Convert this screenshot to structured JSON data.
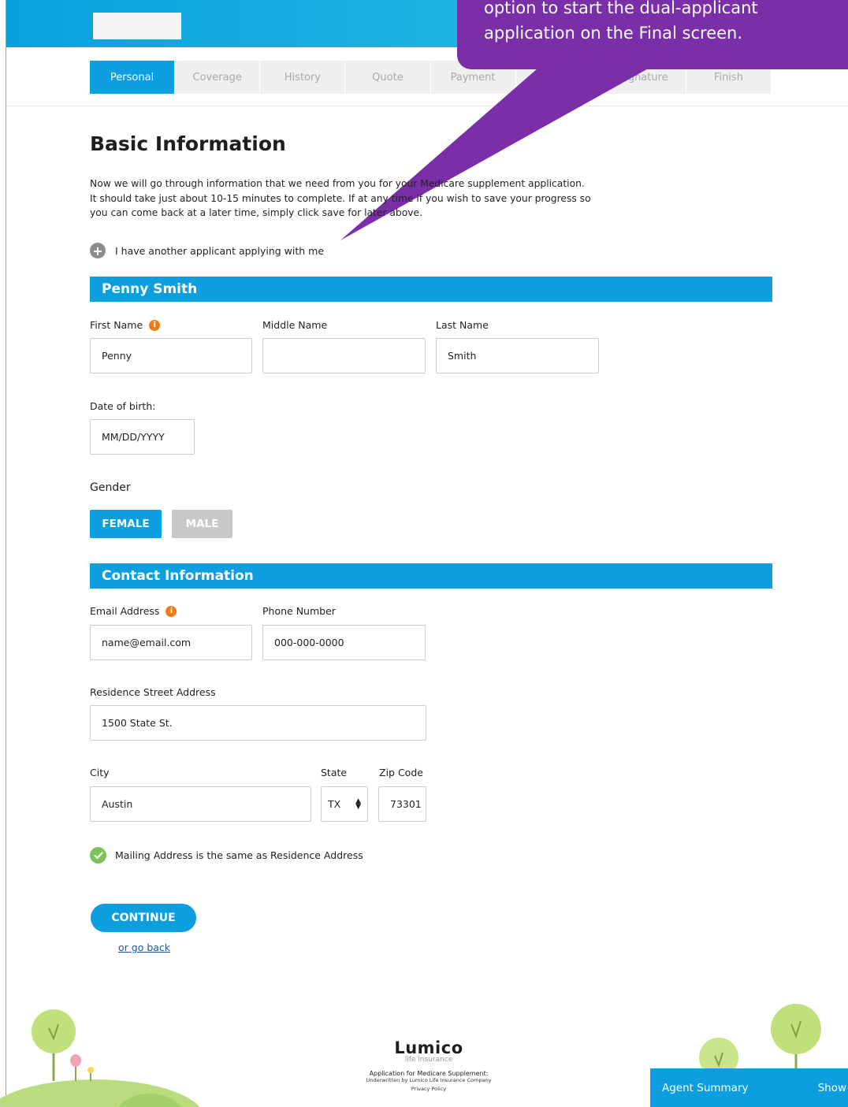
{
  "callout": {
    "line1": "option to start the dual-applicant",
    "line2": "application on the Final screen."
  },
  "steps": [
    {
      "label": "Personal",
      "active": true
    },
    {
      "label": "Coverage",
      "active": false
    },
    {
      "label": "History",
      "active": false
    },
    {
      "label": "Quote",
      "active": false
    },
    {
      "label": "Payment",
      "active": false
    },
    {
      "label": "",
      "active": false
    },
    {
      "label": "Signature",
      "active": false
    },
    {
      "label": "Finish",
      "active": false
    }
  ],
  "page": {
    "title": "Basic Information",
    "intro_line1": "Now we will go through information that we need from you for your Medicare supplement application.",
    "intro_line2": "It should take just about 10-15 minutes to complete. If at any time if you wish to save your progress so",
    "intro_line3": "you can come back at a later time, simply click save for later above.",
    "add_applicant": "I have another applicant applying with me"
  },
  "applicant": {
    "section_title": "Penny Smith",
    "first_name_label": "First Name",
    "first_name_value": "Penny",
    "middle_name_label": "Middle Name",
    "middle_name_value": "",
    "last_name_label": "Last Name",
    "last_name_value": "Smith",
    "dob_label": "Date of birth:",
    "dob_placeholder": "MM/DD/YYYY",
    "gender_label": "Gender",
    "gender_female": "FEMALE",
    "gender_male": "MALE",
    "gender_selected": "FEMALE"
  },
  "contact": {
    "section_title": "Contact Information",
    "email_label": "Email Address",
    "email_placeholder": "name@email.com",
    "phone_label": "Phone Number",
    "phone_placeholder": "000-000-0000",
    "street_label": "Residence Street Address",
    "street_value": "1500 State St.",
    "city_label": "City",
    "city_value": "Austin",
    "state_label": "State",
    "state_value": "TX",
    "zip_label": "Zip Code",
    "zip_value": "73301",
    "mailing_same": "Mailing Address is the same as Residence Address",
    "mailing_same_checked": true
  },
  "actions": {
    "continue": "CONTINUE",
    "go_back": "or go back"
  },
  "footer": {
    "brand": "Lumico",
    "brand_sub": "life insurance",
    "line1": "Application for Medicare Supplement:",
    "line2": "Underwritten by Lumico Life Insurance Company",
    "line3": "Privacy Policy"
  },
  "agent_summary": {
    "label": "Agent Summary",
    "toggle": "Show"
  },
  "colors": {
    "primary": "#0d9ee0",
    "callout": "#7a2ea8",
    "info": "#f07a15",
    "check": "#7cc35a"
  }
}
